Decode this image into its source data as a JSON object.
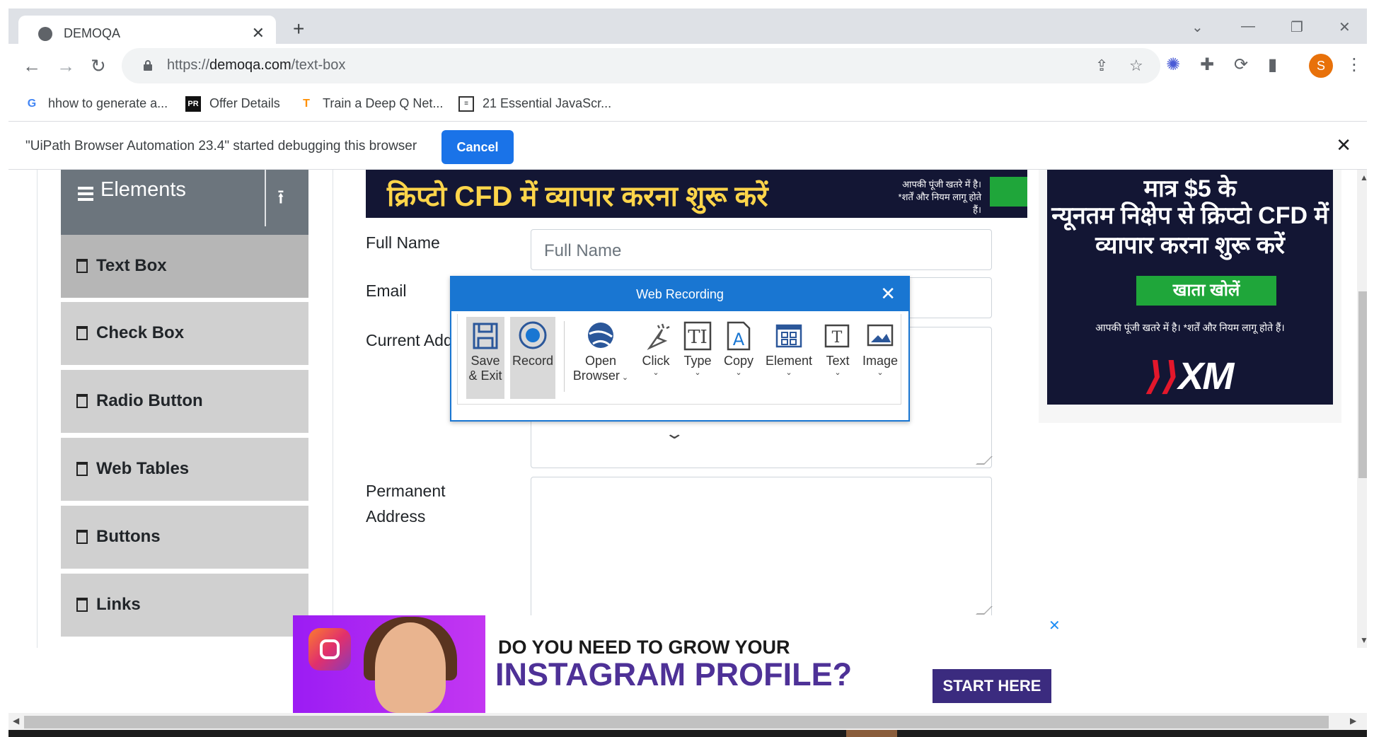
{
  "browser": {
    "tab_title": "DEMOQA",
    "url_prefix": "https://",
    "url_host": "demoqa.com",
    "url_path": "/text-box",
    "profile_initial": "S"
  },
  "bookmarks": [
    {
      "label": "hhow to generate a...",
      "icon": "google-icon"
    },
    {
      "label": "Offer Details",
      "icon": "pr-icon"
    },
    {
      "label": "Train a Deep Q Net...",
      "icon": "tensorflow-icon"
    },
    {
      "label": "21 Essential JavaScr...",
      "icon": "article-icon"
    }
  ],
  "infobar": {
    "message": "\"UiPath Browser Automation 23.4\" started debugging this browser",
    "cancel_label": "Cancel"
  },
  "sidebar": {
    "header": "Elements",
    "items": [
      {
        "label": "Text Box"
      },
      {
        "label": "Check Box"
      },
      {
        "label": "Radio Button"
      },
      {
        "label": "Web Tables"
      },
      {
        "label": "Buttons"
      },
      {
        "label": "Links"
      }
    ]
  },
  "ad_top": {
    "headline": "क्रिप्टो CFD में व्यापार करना शुरू करें",
    "disclaimer_1": "आपकी पूंजी खतरे में है।",
    "disclaimer_2": "*शर्तें और नियम लागू होते हैं।"
  },
  "form": {
    "full_name_label": "Full Name",
    "full_name_placeholder": "Full Name",
    "email_label": "Email",
    "current_address_label": "Current Add",
    "permanent_address_label_1": "Permanent",
    "permanent_address_label_2": "Address"
  },
  "ad_side": {
    "line1": "मात्र $5 के",
    "line2": "न्यूनतम निक्षेप से क्रिप्टो CFD में",
    "line3": "व्यापार करना शुरू करें",
    "button": "खाता खोलें",
    "risk": "आपकी पूंजी खतरे में है। *शर्तें और नियम लागू होते हैं।",
    "logo_text": "XM"
  },
  "web_recording": {
    "title": "Web Recording",
    "tools": [
      {
        "label1": "Save",
        "label2": "& Exit",
        "icon": "save-icon"
      },
      {
        "label1": "Record",
        "label2": "",
        "icon": "record-icon"
      },
      {
        "label1": "Open",
        "label2": "Browser",
        "icon": "open-browser-icon"
      },
      {
        "label1": "Click",
        "label2": "",
        "icon": "click-icon"
      },
      {
        "label1": "Type",
        "label2": "",
        "icon": "type-icon"
      },
      {
        "label1": "Copy",
        "label2": "",
        "icon": "copy-icon"
      },
      {
        "label1": "Element",
        "label2": "",
        "icon": "element-icon"
      },
      {
        "label1": "Text",
        "label2": "",
        "icon": "text-icon"
      },
      {
        "label1": "Image",
        "label2": "",
        "icon": "image-icon"
      }
    ]
  },
  "ad_bottom": {
    "line1": "DO YOU NEED TO GROW YOUR",
    "line2": "INSTAGRAM PROFILE?",
    "cta": "START HERE"
  },
  "colors": {
    "accent": "#1976d2",
    "chrome_blue": "#1a73e8",
    "sidebar_header": "#6c757d",
    "ad_green": "#1fa63a"
  }
}
